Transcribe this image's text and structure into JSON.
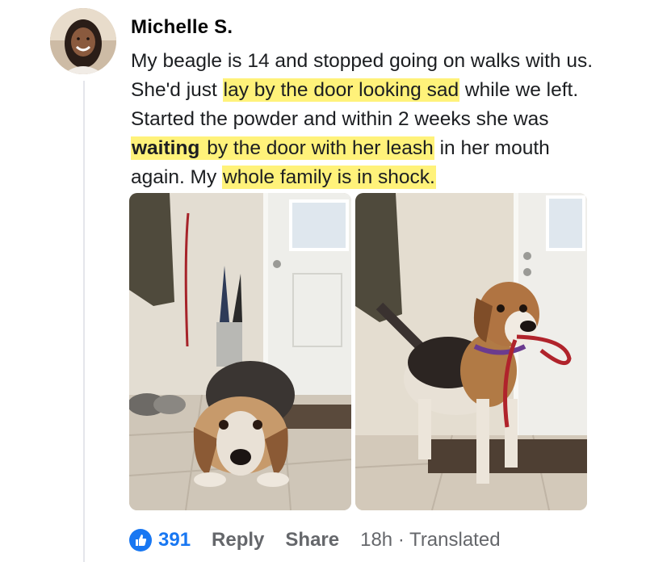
{
  "comment": {
    "author": "Michelle S.",
    "segments": [
      {
        "text": "My beagle is 14 and stopped going on walks with us. She'd just ",
        "style": "plain"
      },
      {
        "text": "lay by the door looking sad",
        "style": "highlight"
      },
      {
        "text": " while we left. Started the powder and within 2 weeks she was ",
        "style": "plain"
      },
      {
        "text": "waiting",
        "style": "highlight-bold"
      },
      {
        "text": " by the door with her leash",
        "style": "highlight"
      },
      {
        "text": " in her mouth again. My ",
        "style": "plain"
      },
      {
        "text": "whole family is in shock.",
        "style": "highlight"
      }
    ]
  },
  "photos": {
    "before": {
      "subject": "elderly beagle lying on floor by door"
    },
    "after": {
      "subject": "beagle standing holding red leash in mouth"
    }
  },
  "actions": {
    "like_count": "391",
    "reply_label": "Reply",
    "share_label": "Share",
    "meta": "18h · Translated"
  },
  "colors": {
    "highlight": "#fff27a",
    "like_blue": "#1877f2",
    "muted": "#65676b"
  },
  "icons": {
    "like": "thumbs-up-icon"
  }
}
